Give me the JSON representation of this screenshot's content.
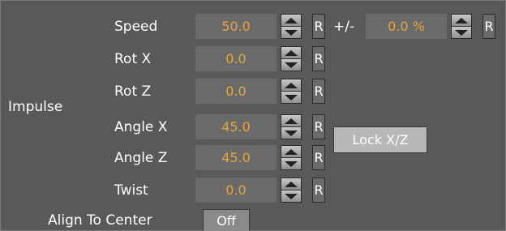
{
  "group_label": "Impulse",
  "rows": [
    {
      "label": "Speed",
      "value": "50.0",
      "reset": "R"
    },
    {
      "label": "Rot X",
      "value": "0.0",
      "reset": "R"
    },
    {
      "label": "Rot Z",
      "value": "0.0",
      "reset": "R"
    },
    {
      "label": "Angle X",
      "value": "45.0",
      "reset": "R"
    },
    {
      "label": "Angle Z",
      "value": "45.0",
      "reset": "R"
    },
    {
      "label": "Twist",
      "value": "0.0",
      "reset": "R"
    }
  ],
  "variance": {
    "label": "+/-",
    "value": "0.0 %",
    "reset": "R"
  },
  "lock_button": "Lock X/Z",
  "align": {
    "label": "Align To Center",
    "value": "Off"
  },
  "icons": {
    "stepper_up": "arrow-up-icon",
    "stepper_down": "arrow-down-icon"
  },
  "colors": {
    "panel_bg": "#595959",
    "field_bg": "#6a6a6a",
    "value_text": "#e7a53c",
    "label_text": "#ffffff"
  }
}
